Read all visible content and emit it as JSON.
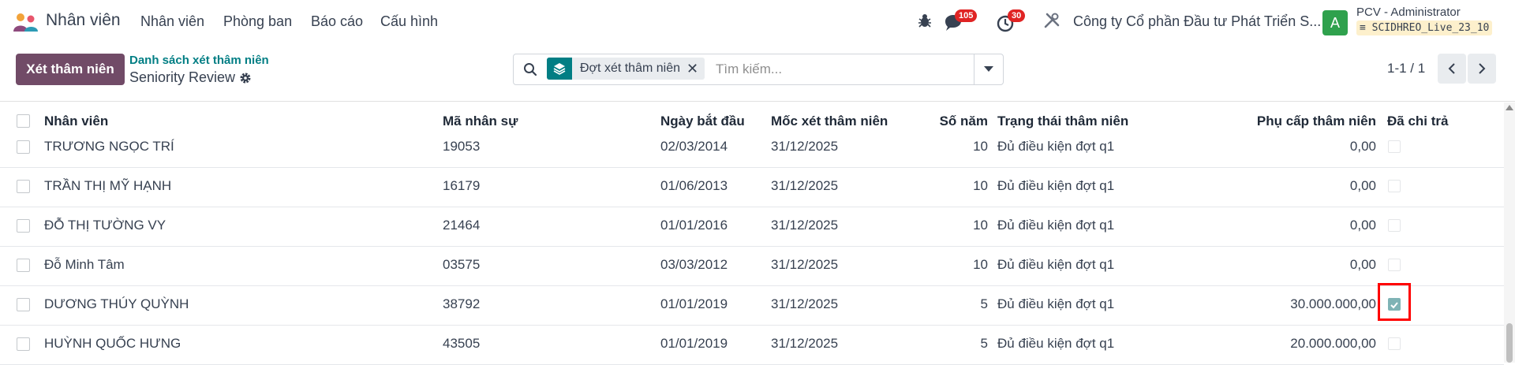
{
  "navbar": {
    "app_name": "Nhân viên",
    "menu": [
      "Nhân viên",
      "Phòng ban",
      "Báo cáo",
      "Cấu hình"
    ],
    "messages_badge": "105",
    "activity_badge": "30",
    "company": "Công ty Cổ phần Đầu tư Phát Triển S...",
    "avatar_letter": "A",
    "user_name": "PCV - Administrator",
    "database": "SCIDHREO_Live_23_10"
  },
  "control": {
    "primary_button": "Xét thâm niên",
    "breadcrumb_parent": "Danh sách xét thâm niên",
    "breadcrumb_current": "Seniority Review",
    "facet_label": "Đợt xét thâm niên",
    "search_placeholder": "Tìm kiếm...",
    "pager": "1-1 / 1"
  },
  "table": {
    "columns": [
      "Nhân viên",
      "Mã nhân sự",
      "Ngày bắt đầu",
      "Mốc xét thâm niên",
      "Số năm",
      "Trạng thái thâm niên",
      "Phụ cấp thâm niên",
      "Đã chi trả"
    ],
    "rows": [
      {
        "name": "TRƯƠNG NGỌC TRÍ",
        "code": "19053",
        "start": "02/03/2014",
        "review": "31/12/2025",
        "years": "10",
        "status": "Đủ điều kiện đợt q1",
        "allowance": "0,00",
        "paid": false
      },
      {
        "name": "TRẦN THỊ MỸ HẠNH",
        "code": "16179",
        "start": "01/06/2013",
        "review": "31/12/2025",
        "years": "10",
        "status": "Đủ điều kiện đợt q1",
        "allowance": "0,00",
        "paid": false
      },
      {
        "name": "ĐỖ THỊ TƯỜNG VY",
        "code": "21464",
        "start": "01/01/2016",
        "review": "31/12/2025",
        "years": "10",
        "status": "Đủ điều kiện đợt q1",
        "allowance": "0,00",
        "paid": false
      },
      {
        "name": "Đỗ Minh Tâm",
        "code": "03575",
        "start": "03/03/2012",
        "review": "31/12/2025",
        "years": "10",
        "status": "Đủ điều kiện đợt q1",
        "allowance": "0,00",
        "paid": false
      },
      {
        "name": "DƯƠNG THÚY QUỲNH",
        "code": "38792",
        "start": "01/01/2019",
        "review": "31/12/2025",
        "years": "5",
        "status": "Đủ điều kiện đợt q1",
        "allowance": "30.000.000,00",
        "paid": true
      },
      {
        "name": "HUỲNH QUỐC HƯNG",
        "code": "43505",
        "start": "01/01/2019",
        "review": "31/12/2025",
        "years": "5",
        "status": "Đủ điều kiện đợt q1",
        "allowance": "20.000.000,00",
        "paid": false
      }
    ]
  },
  "colors": {
    "brand": "#714b67",
    "teal": "#017e84",
    "badge": "#e02424",
    "avatar": "#2fa14d",
    "highlight": "#ff0000"
  }
}
